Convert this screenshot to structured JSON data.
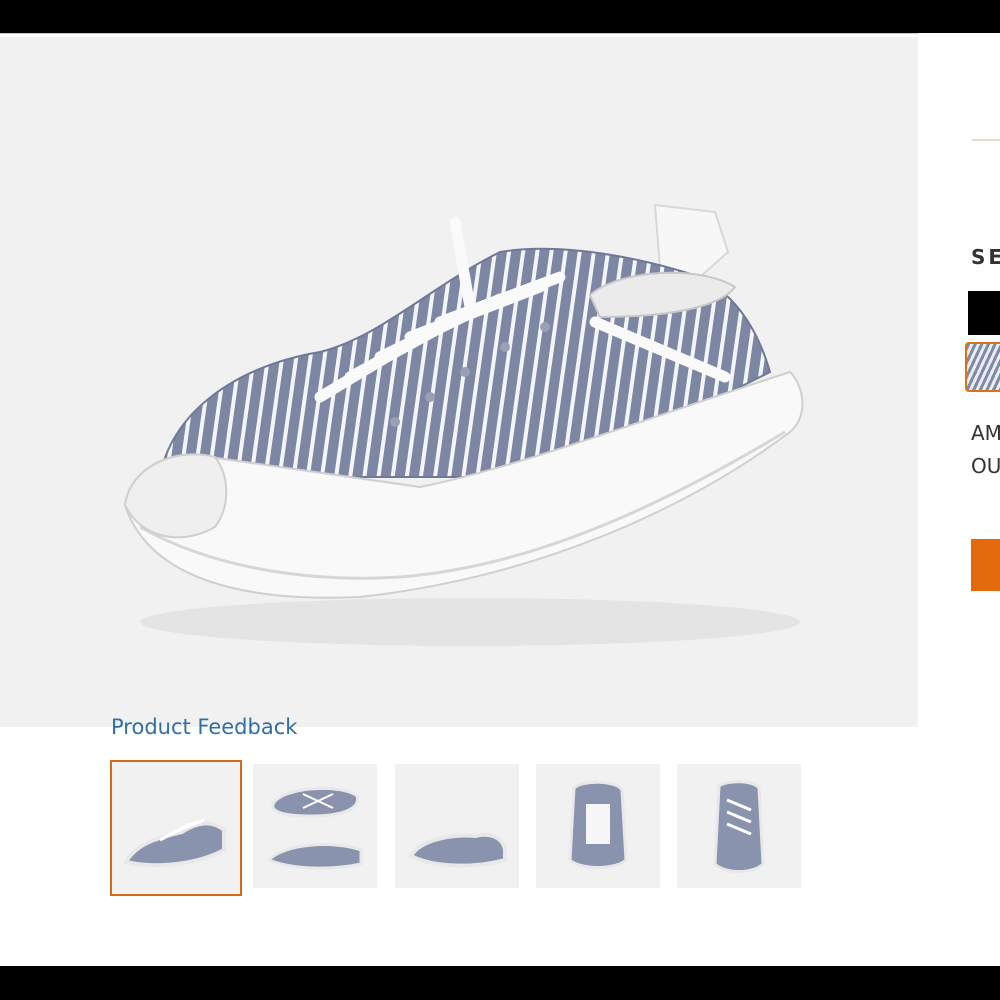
{
  "product": {
    "feedback_link": "Product Feedback",
    "image_alt": "striped canvas lace-up sneaker"
  },
  "thumbnails": [
    {
      "view": "side-angle",
      "selected": true
    },
    {
      "view": "top-and-side",
      "selected": false
    },
    {
      "view": "side",
      "selected": false
    },
    {
      "view": "back",
      "selected": false
    },
    {
      "view": "front",
      "selected": false
    }
  ],
  "right_panel": {
    "select_label": "SE",
    "colors": [
      {
        "name": "black",
        "hex": "#000000",
        "selected": false
      },
      {
        "name": "stripe",
        "hex": "#7f8aa6",
        "selected": true
      }
    ],
    "info_line_1": "AM",
    "info_line_2": "OU"
  },
  "colors": {
    "accent": "#e36a0d",
    "link": "#2f6fa7",
    "thumb_border": "#d26c16"
  }
}
